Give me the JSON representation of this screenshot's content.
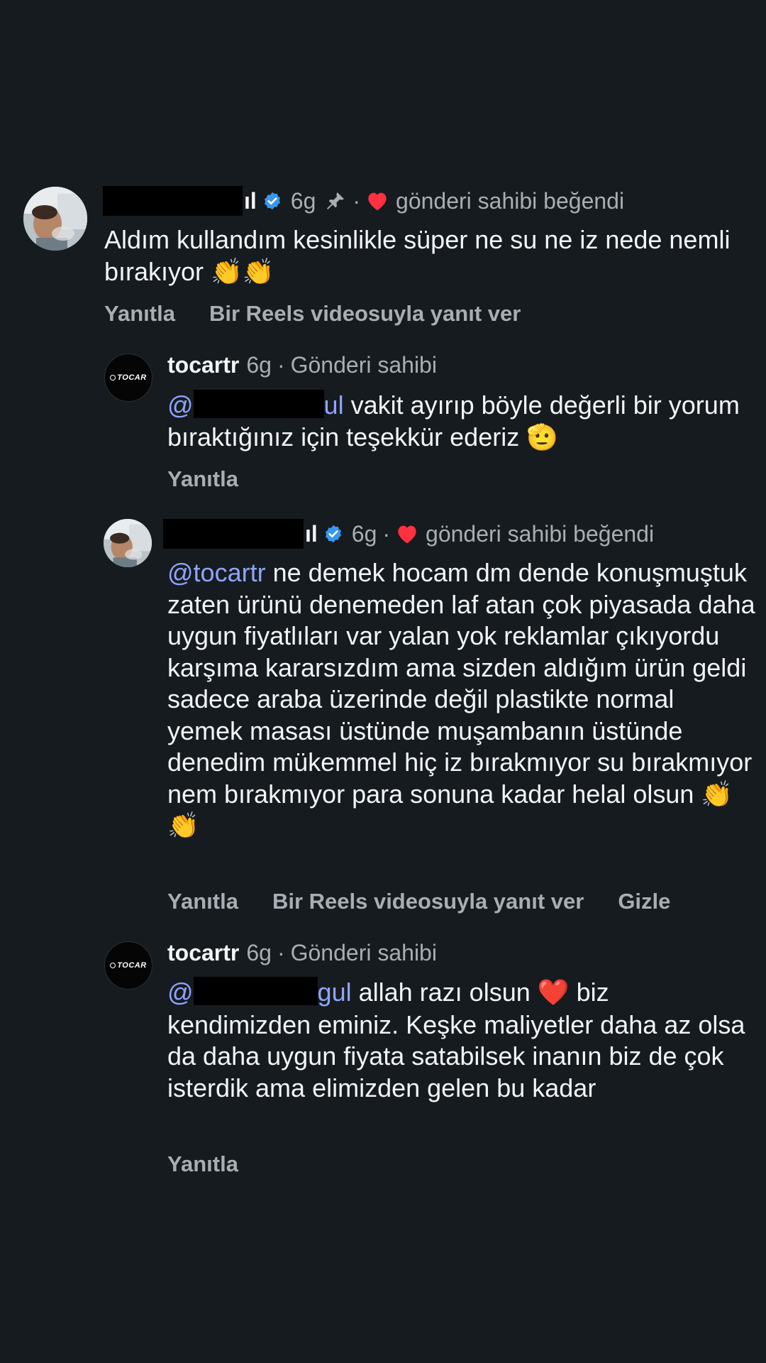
{
  "comments": [
    {
      "username_suffix": "ıl",
      "time": "6g",
      "liked_label": "gönderi sahibi beğendi",
      "text": "Aldım kullandım kesinlikle süper ne su ne iz nede nemli bırakıyor 👏👏",
      "actions": [
        "Yanıtla",
        "Bir Reels videosuyla yanıt ver"
      ]
    },
    {
      "username": "tocartr",
      "time": "6g",
      "role": "Gönderi sahibi",
      "mention_suffix": "ul",
      "text": " vakit ayırıp böyle değerli bir yorum bıraktığınız için teşekkür ederiz 🫡",
      "actions": [
        "Yanıtla"
      ]
    },
    {
      "username_suffix": "ıl",
      "time": "6g",
      "liked_label": "gönderi sahibi beğendi",
      "mention": "@tocartr",
      "text": " ne demek hocam dm dende konuşmuştuk zaten ürünü denemeden laf atan çok piyasada daha uygun fiyatlıları var yalan yok reklamlar çıkıyordu karşıma kararsızdım ama sizden aldığım ürün geldi sadece araba üzerinde değil plastikte normal yemek masası üstünde muşambanın üstünde denedim mükemmel hiç iz bırakmıyor su bırakmıyor nem bırakmıyor para sonuna kadar helal olsun 👏👏",
      "actions": [
        "Yanıtla",
        "Bir Reels videosuyla yanıt ver",
        "Gizle"
      ]
    },
    {
      "username": "tocartr",
      "time": "6g",
      "role": "Gönderi sahibi",
      "mention_prefix": "@",
      "mention_suffix": "gul",
      "text_a": " allah razı olsun ",
      "heart_emoji": "❤️",
      "text_b": " biz kendimizden eminiz. Keşke maliyetler daha az olsa da daha uygun fiyata satabilsek inanın biz de çok isterdik ama elimizden gelen bu kadar",
      "actions": [
        "Yanıtla"
      ]
    }
  ],
  "brand_logo_text": "TOCAR",
  "colors": {
    "background": "#161b1f",
    "text": "#f3f5f7",
    "muted": "#a8aeb4",
    "mention": "#8fa4ff",
    "verified": "#3897f0",
    "heart": "#ff3040"
  },
  "icons": [
    "verified-badge-icon",
    "pin-icon",
    "heart-icon"
  ]
}
